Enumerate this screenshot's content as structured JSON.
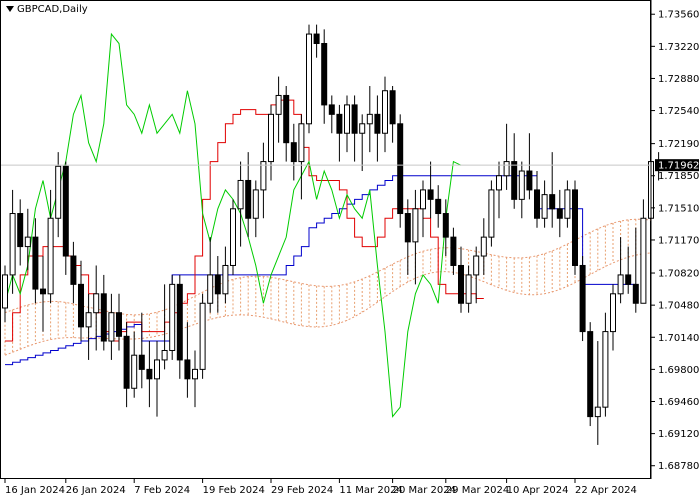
{
  "chart_data": {
    "type": "candlestick",
    "title": "GBPCAD,Daily",
    "y_ticks": [
      "1.73560",
      "1.73220",
      "1.72880",
      "1.72540",
      "1.72190",
      "1.71850",
      "1.71510",
      "1.71170",
      "1.70820",
      "1.70480",
      "1.70140",
      "1.69800",
      "1.69460",
      "1.69120",
      "1.68780"
    ],
    "ylim": [
      1.6865,
      1.737
    ],
    "x_ticks": [
      "16 Jan 2024",
      "26 Jan 2024",
      "7 Feb 2024",
      "19 Feb 2024",
      "29 Feb 2024",
      "11 Mar 2024",
      "20 Mar 2024",
      "29 Mar 2024",
      "10 Apr 2024",
      "22 Apr 2024"
    ],
    "current_price": "1.71962",
    "current_price_value": 1.71962,
    "colors": {
      "grid": "#c0c0c0",
      "tenkan_sen": "#e00000",
      "kijun_sen": "#0000cc",
      "chikou_span": "#00cc00",
      "cloud_edge": "#e89870",
      "cloud_hatch": "#e8a070",
      "candle_bull_fill": "#ffffff",
      "candle_bear_fill": "#000000",
      "candle_outline": "#000000",
      "price_line": "#c8c8c8",
      "price_label_bg": "#000000",
      "price_label_text": "#ffffff"
    },
    "candles": [
      [
        1.7045,
        1.709,
        1.703,
        1.708
      ],
      [
        1.708,
        1.717,
        1.706,
        1.7145
      ],
      [
        1.7145,
        1.716,
        1.709,
        1.711
      ],
      [
        1.711,
        1.715,
        1.7085,
        1.712
      ],
      [
        1.712,
        1.714,
        1.705,
        1.7065
      ],
      [
        1.7065,
        1.71,
        1.702,
        1.706
      ],
      [
        1.706,
        1.717,
        1.705,
        1.714
      ],
      [
        1.714,
        1.721,
        1.712,
        1.7195
      ],
      [
        1.7195,
        1.72,
        1.708,
        1.71
      ],
      [
        1.71,
        1.7115,
        1.705,
        1.707
      ],
      [
        1.707,
        1.7095,
        1.701,
        1.7025
      ],
      [
        1.7025,
        1.706,
        1.699,
        1.704
      ],
      [
        1.704,
        1.709,
        1.7,
        1.706
      ],
      [
        1.706,
        1.708,
        1.7,
        1.701
      ],
      [
        1.701,
        1.706,
        1.699,
        1.704
      ],
      [
        1.704,
        1.706,
        1.7,
        1.7015
      ],
      [
        1.7015,
        1.703,
        1.694,
        1.696
      ],
      [
        1.696,
        1.702,
        1.695,
        1.6995
      ],
      [
        1.6995,
        1.704,
        1.696,
        1.698
      ],
      [
        1.698,
        1.701,
        1.694,
        1.697
      ],
      [
        1.697,
        1.701,
        1.693,
        1.699
      ],
      [
        1.699,
        1.707,
        1.698,
        1.7
      ],
      [
        1.7,
        1.708,
        1.699,
        1.707
      ],
      [
        1.707,
        1.708,
        1.697,
        1.699
      ],
      [
        1.699,
        1.703,
        1.695,
        1.697
      ],
      [
        1.697,
        1.7,
        1.694,
        1.698
      ],
      [
        1.698,
        1.706,
        1.697,
        1.705
      ],
      [
        1.705,
        1.712,
        1.704,
        1.708
      ],
      [
        1.708,
        1.71,
        1.704,
        1.706
      ],
      [
        1.706,
        1.711,
        1.705,
        1.709
      ],
      [
        1.709,
        1.716,
        1.708,
        1.715
      ],
      [
        1.715,
        1.72,
        1.711,
        1.718
      ],
      [
        1.718,
        1.721,
        1.712,
        1.714
      ],
      [
        1.714,
        1.718,
        1.712,
        1.717
      ],
      [
        1.717,
        1.722,
        1.714,
        1.72
      ],
      [
        1.72,
        1.726,
        1.718,
        1.725
      ],
      [
        1.725,
        1.729,
        1.722,
        1.727
      ],
      [
        1.727,
        1.728,
        1.72,
        1.722
      ],
      [
        1.722,
        1.724,
        1.718,
        1.72
      ],
      [
        1.72,
        1.725,
        1.716,
        1.724
      ],
      [
        1.724,
        1.7345,
        1.723,
        1.7335
      ],
      [
        1.7335,
        1.7345,
        1.731,
        1.7325
      ],
      [
        1.7325,
        1.734,
        1.724,
        1.726
      ],
      [
        1.726,
        1.727,
        1.723,
        1.725
      ],
      [
        1.725,
        1.726,
        1.72,
        1.723
      ],
      [
        1.723,
        1.727,
        1.721,
        1.726
      ],
      [
        1.726,
        1.727,
        1.72,
        1.723
      ],
      [
        1.723,
        1.725,
        1.719,
        1.724
      ],
      [
        1.724,
        1.728,
        1.721,
        1.725
      ],
      [
        1.725,
        1.727,
        1.72,
        1.723
      ],
      [
        1.723,
        1.729,
        1.721,
        1.7275
      ],
      [
        1.7275,
        1.728,
        1.722,
        1.724
      ],
      [
        1.724,
        1.725,
        1.713,
        1.7145
      ],
      [
        1.7145,
        1.716,
        1.708,
        1.7115
      ],
      [
        1.7115,
        1.717,
        1.707,
        1.715
      ],
      [
        1.715,
        1.718,
        1.712,
        1.717
      ],
      [
        1.717,
        1.72,
        1.714,
        1.716
      ],
      [
        1.716,
        1.7175,
        1.713,
        1.7145
      ],
      [
        1.7145,
        1.716,
        1.71,
        1.712
      ],
      [
        1.712,
        1.713,
        1.708,
        1.709
      ],
      [
        1.709,
        1.711,
        1.704,
        1.705
      ],
      [
        1.705,
        1.709,
        1.704,
        1.708
      ],
      [
        1.708,
        1.711,
        1.705,
        1.71
      ],
      [
        1.71,
        1.714,
        1.708,
        1.712
      ],
      [
        1.712,
        1.718,
        1.711,
        1.717
      ],
      [
        1.717,
        1.72,
        1.714,
        1.7185
      ],
      [
        1.7185,
        1.724,
        1.717,
        1.72
      ],
      [
        1.72,
        1.723,
        1.715,
        1.716
      ],
      [
        1.716,
        1.72,
        1.714,
        1.719
      ],
      [
        1.719,
        1.723,
        1.716,
        1.717
      ],
      [
        1.717,
        1.719,
        1.713,
        1.714
      ],
      [
        1.714,
        1.718,
        1.713,
        1.7165
      ],
      [
        1.7165,
        1.721,
        1.713,
        1.715
      ],
      [
        1.715,
        1.717,
        1.712,
        1.714
      ],
      [
        1.714,
        1.718,
        1.713,
        1.717
      ],
      [
        1.717,
        1.718,
        1.708,
        1.709
      ],
      [
        1.709,
        1.71,
        1.701,
        1.702
      ],
      [
        1.702,
        1.703,
        1.692,
        1.693
      ],
      [
        1.693,
        1.701,
        1.69,
        1.694
      ],
      [
        1.694,
        1.704,
        1.693,
        1.702
      ],
      [
        1.702,
        1.707,
        1.7,
        1.706
      ],
      [
        1.706,
        1.712,
        1.705,
        1.708
      ],
      [
        1.708,
        1.711,
        1.706,
        1.707
      ],
      [
        1.707,
        1.713,
        1.704,
        1.705
      ],
      [
        1.705,
        1.716,
        1.705,
        1.714
      ],
      [
        1.714,
        1.722,
        1.711,
        1.72
      ],
      [
        1.72,
        1.721,
        1.718,
        1.7196
      ]
    ],
    "tenkan_sen": [
      1.701,
      1.704,
      1.708,
      1.71,
      1.71,
      1.711,
      1.711,
      1.711,
      1.71,
      1.709,
      1.708,
      1.706,
      1.704,
      1.702,
      1.701,
      1.702,
      1.703,
      1.703,
      1.702,
      1.702,
      1.702,
      1.703,
      1.704,
      1.705,
      1.706,
      1.71,
      1.716,
      1.72,
      1.722,
      1.724,
      1.725,
      1.7255,
      1.7255,
      1.725,
      1.725,
      1.726,
      1.7265,
      1.7265,
      1.725,
      1.7215,
      1.7185,
      1.718,
      1.718,
      1.718,
      1.717,
      1.714,
      1.712,
      1.711,
      1.711,
      1.712,
      1.714,
      1.715,
      1.715,
      1.715,
      1.715,
      1.714,
      1.712,
      1.707,
      1.706,
      1.706,
      1.706,
      1.706,
      1.7055,
      1.7055
    ],
    "tenkan_x": [
      0,
      1,
      2,
      3,
      4,
      5,
      6,
      7,
      8,
      9,
      10,
      11,
      12,
      13,
      14,
      15,
      16,
      17,
      18,
      19,
      20,
      21,
      22,
      23,
      24,
      25,
      26,
      27,
      28,
      29,
      30,
      31,
      32,
      33,
      34,
      35,
      36,
      37,
      38,
      39,
      40,
      41,
      42,
      43,
      44,
      45,
      46,
      47,
      48,
      49,
      50,
      51,
      52,
      53,
      54,
      55,
      56,
      57,
      58,
      59,
      60,
      61,
      62,
      63
    ]
  }
}
